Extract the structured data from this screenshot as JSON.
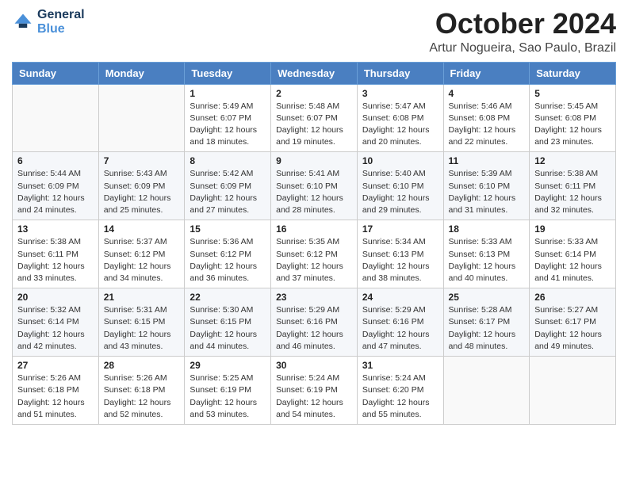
{
  "header": {
    "logo_line1": "General",
    "logo_line2": "Blue",
    "month": "October 2024",
    "location": "Artur Nogueira, Sao Paulo, Brazil"
  },
  "weekdays": [
    "Sunday",
    "Monday",
    "Tuesday",
    "Wednesday",
    "Thursday",
    "Friday",
    "Saturday"
  ],
  "weeks": [
    [
      {
        "day": null
      },
      {
        "day": null
      },
      {
        "day": "1",
        "sunrise": "Sunrise: 5:49 AM",
        "sunset": "Sunset: 6:07 PM",
        "daylight": "Daylight: 12 hours and 18 minutes."
      },
      {
        "day": "2",
        "sunrise": "Sunrise: 5:48 AM",
        "sunset": "Sunset: 6:07 PM",
        "daylight": "Daylight: 12 hours and 19 minutes."
      },
      {
        "day": "3",
        "sunrise": "Sunrise: 5:47 AM",
        "sunset": "Sunset: 6:08 PM",
        "daylight": "Daylight: 12 hours and 20 minutes."
      },
      {
        "day": "4",
        "sunrise": "Sunrise: 5:46 AM",
        "sunset": "Sunset: 6:08 PM",
        "daylight": "Daylight: 12 hours and 22 minutes."
      },
      {
        "day": "5",
        "sunrise": "Sunrise: 5:45 AM",
        "sunset": "Sunset: 6:08 PM",
        "daylight": "Daylight: 12 hours and 23 minutes."
      }
    ],
    [
      {
        "day": "6",
        "sunrise": "Sunrise: 5:44 AM",
        "sunset": "Sunset: 6:09 PM",
        "daylight": "Daylight: 12 hours and 24 minutes."
      },
      {
        "day": "7",
        "sunrise": "Sunrise: 5:43 AM",
        "sunset": "Sunset: 6:09 PM",
        "daylight": "Daylight: 12 hours and 25 minutes."
      },
      {
        "day": "8",
        "sunrise": "Sunrise: 5:42 AM",
        "sunset": "Sunset: 6:09 PM",
        "daylight": "Daylight: 12 hours and 27 minutes."
      },
      {
        "day": "9",
        "sunrise": "Sunrise: 5:41 AM",
        "sunset": "Sunset: 6:10 PM",
        "daylight": "Daylight: 12 hours and 28 minutes."
      },
      {
        "day": "10",
        "sunrise": "Sunrise: 5:40 AM",
        "sunset": "Sunset: 6:10 PM",
        "daylight": "Daylight: 12 hours and 29 minutes."
      },
      {
        "day": "11",
        "sunrise": "Sunrise: 5:39 AM",
        "sunset": "Sunset: 6:10 PM",
        "daylight": "Daylight: 12 hours and 31 minutes."
      },
      {
        "day": "12",
        "sunrise": "Sunrise: 5:38 AM",
        "sunset": "Sunset: 6:11 PM",
        "daylight": "Daylight: 12 hours and 32 minutes."
      }
    ],
    [
      {
        "day": "13",
        "sunrise": "Sunrise: 5:38 AM",
        "sunset": "Sunset: 6:11 PM",
        "daylight": "Daylight: 12 hours and 33 minutes."
      },
      {
        "day": "14",
        "sunrise": "Sunrise: 5:37 AM",
        "sunset": "Sunset: 6:12 PM",
        "daylight": "Daylight: 12 hours and 34 minutes."
      },
      {
        "day": "15",
        "sunrise": "Sunrise: 5:36 AM",
        "sunset": "Sunset: 6:12 PM",
        "daylight": "Daylight: 12 hours and 36 minutes."
      },
      {
        "day": "16",
        "sunrise": "Sunrise: 5:35 AM",
        "sunset": "Sunset: 6:12 PM",
        "daylight": "Daylight: 12 hours and 37 minutes."
      },
      {
        "day": "17",
        "sunrise": "Sunrise: 5:34 AM",
        "sunset": "Sunset: 6:13 PM",
        "daylight": "Daylight: 12 hours and 38 minutes."
      },
      {
        "day": "18",
        "sunrise": "Sunrise: 5:33 AM",
        "sunset": "Sunset: 6:13 PM",
        "daylight": "Daylight: 12 hours and 40 minutes."
      },
      {
        "day": "19",
        "sunrise": "Sunrise: 5:33 AM",
        "sunset": "Sunset: 6:14 PM",
        "daylight": "Daylight: 12 hours and 41 minutes."
      }
    ],
    [
      {
        "day": "20",
        "sunrise": "Sunrise: 5:32 AM",
        "sunset": "Sunset: 6:14 PM",
        "daylight": "Daylight: 12 hours and 42 minutes."
      },
      {
        "day": "21",
        "sunrise": "Sunrise: 5:31 AM",
        "sunset": "Sunset: 6:15 PM",
        "daylight": "Daylight: 12 hours and 43 minutes."
      },
      {
        "day": "22",
        "sunrise": "Sunrise: 5:30 AM",
        "sunset": "Sunset: 6:15 PM",
        "daylight": "Daylight: 12 hours and 44 minutes."
      },
      {
        "day": "23",
        "sunrise": "Sunrise: 5:29 AM",
        "sunset": "Sunset: 6:16 PM",
        "daylight": "Daylight: 12 hours and 46 minutes."
      },
      {
        "day": "24",
        "sunrise": "Sunrise: 5:29 AM",
        "sunset": "Sunset: 6:16 PM",
        "daylight": "Daylight: 12 hours and 47 minutes."
      },
      {
        "day": "25",
        "sunrise": "Sunrise: 5:28 AM",
        "sunset": "Sunset: 6:17 PM",
        "daylight": "Daylight: 12 hours and 48 minutes."
      },
      {
        "day": "26",
        "sunrise": "Sunrise: 5:27 AM",
        "sunset": "Sunset: 6:17 PM",
        "daylight": "Daylight: 12 hours and 49 minutes."
      }
    ],
    [
      {
        "day": "27",
        "sunrise": "Sunrise: 5:26 AM",
        "sunset": "Sunset: 6:18 PM",
        "daylight": "Daylight: 12 hours and 51 minutes."
      },
      {
        "day": "28",
        "sunrise": "Sunrise: 5:26 AM",
        "sunset": "Sunset: 6:18 PM",
        "daylight": "Daylight: 12 hours and 52 minutes."
      },
      {
        "day": "29",
        "sunrise": "Sunrise: 5:25 AM",
        "sunset": "Sunset: 6:19 PM",
        "daylight": "Daylight: 12 hours and 53 minutes."
      },
      {
        "day": "30",
        "sunrise": "Sunrise: 5:24 AM",
        "sunset": "Sunset: 6:19 PM",
        "daylight": "Daylight: 12 hours and 54 minutes."
      },
      {
        "day": "31",
        "sunrise": "Sunrise: 5:24 AM",
        "sunset": "Sunset: 6:20 PM",
        "daylight": "Daylight: 12 hours and 55 minutes."
      },
      {
        "day": null
      },
      {
        "day": null
      }
    ]
  ]
}
